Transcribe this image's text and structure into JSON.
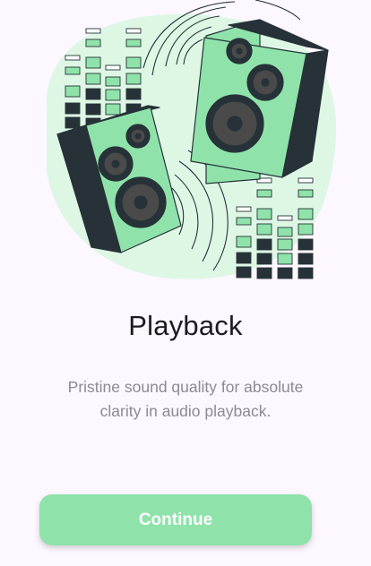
{
  "onboarding": {
    "title": "Playback",
    "description": "Pristine sound quality for absolute clarity in audio playback.",
    "continue_label": "Continue"
  },
  "colors": {
    "background": "#fdf7ff",
    "accent_green": "#8fe3aa",
    "light_green": "#def7e5",
    "dark": "#263238",
    "title": "#1d1b20",
    "description": "#8d8a91"
  },
  "illustration": {
    "subject": "two-speakers-with-equalizer-bars",
    "icons": [
      "speaker-icon",
      "equalizer-icon",
      "sound-wave-icon"
    ]
  }
}
